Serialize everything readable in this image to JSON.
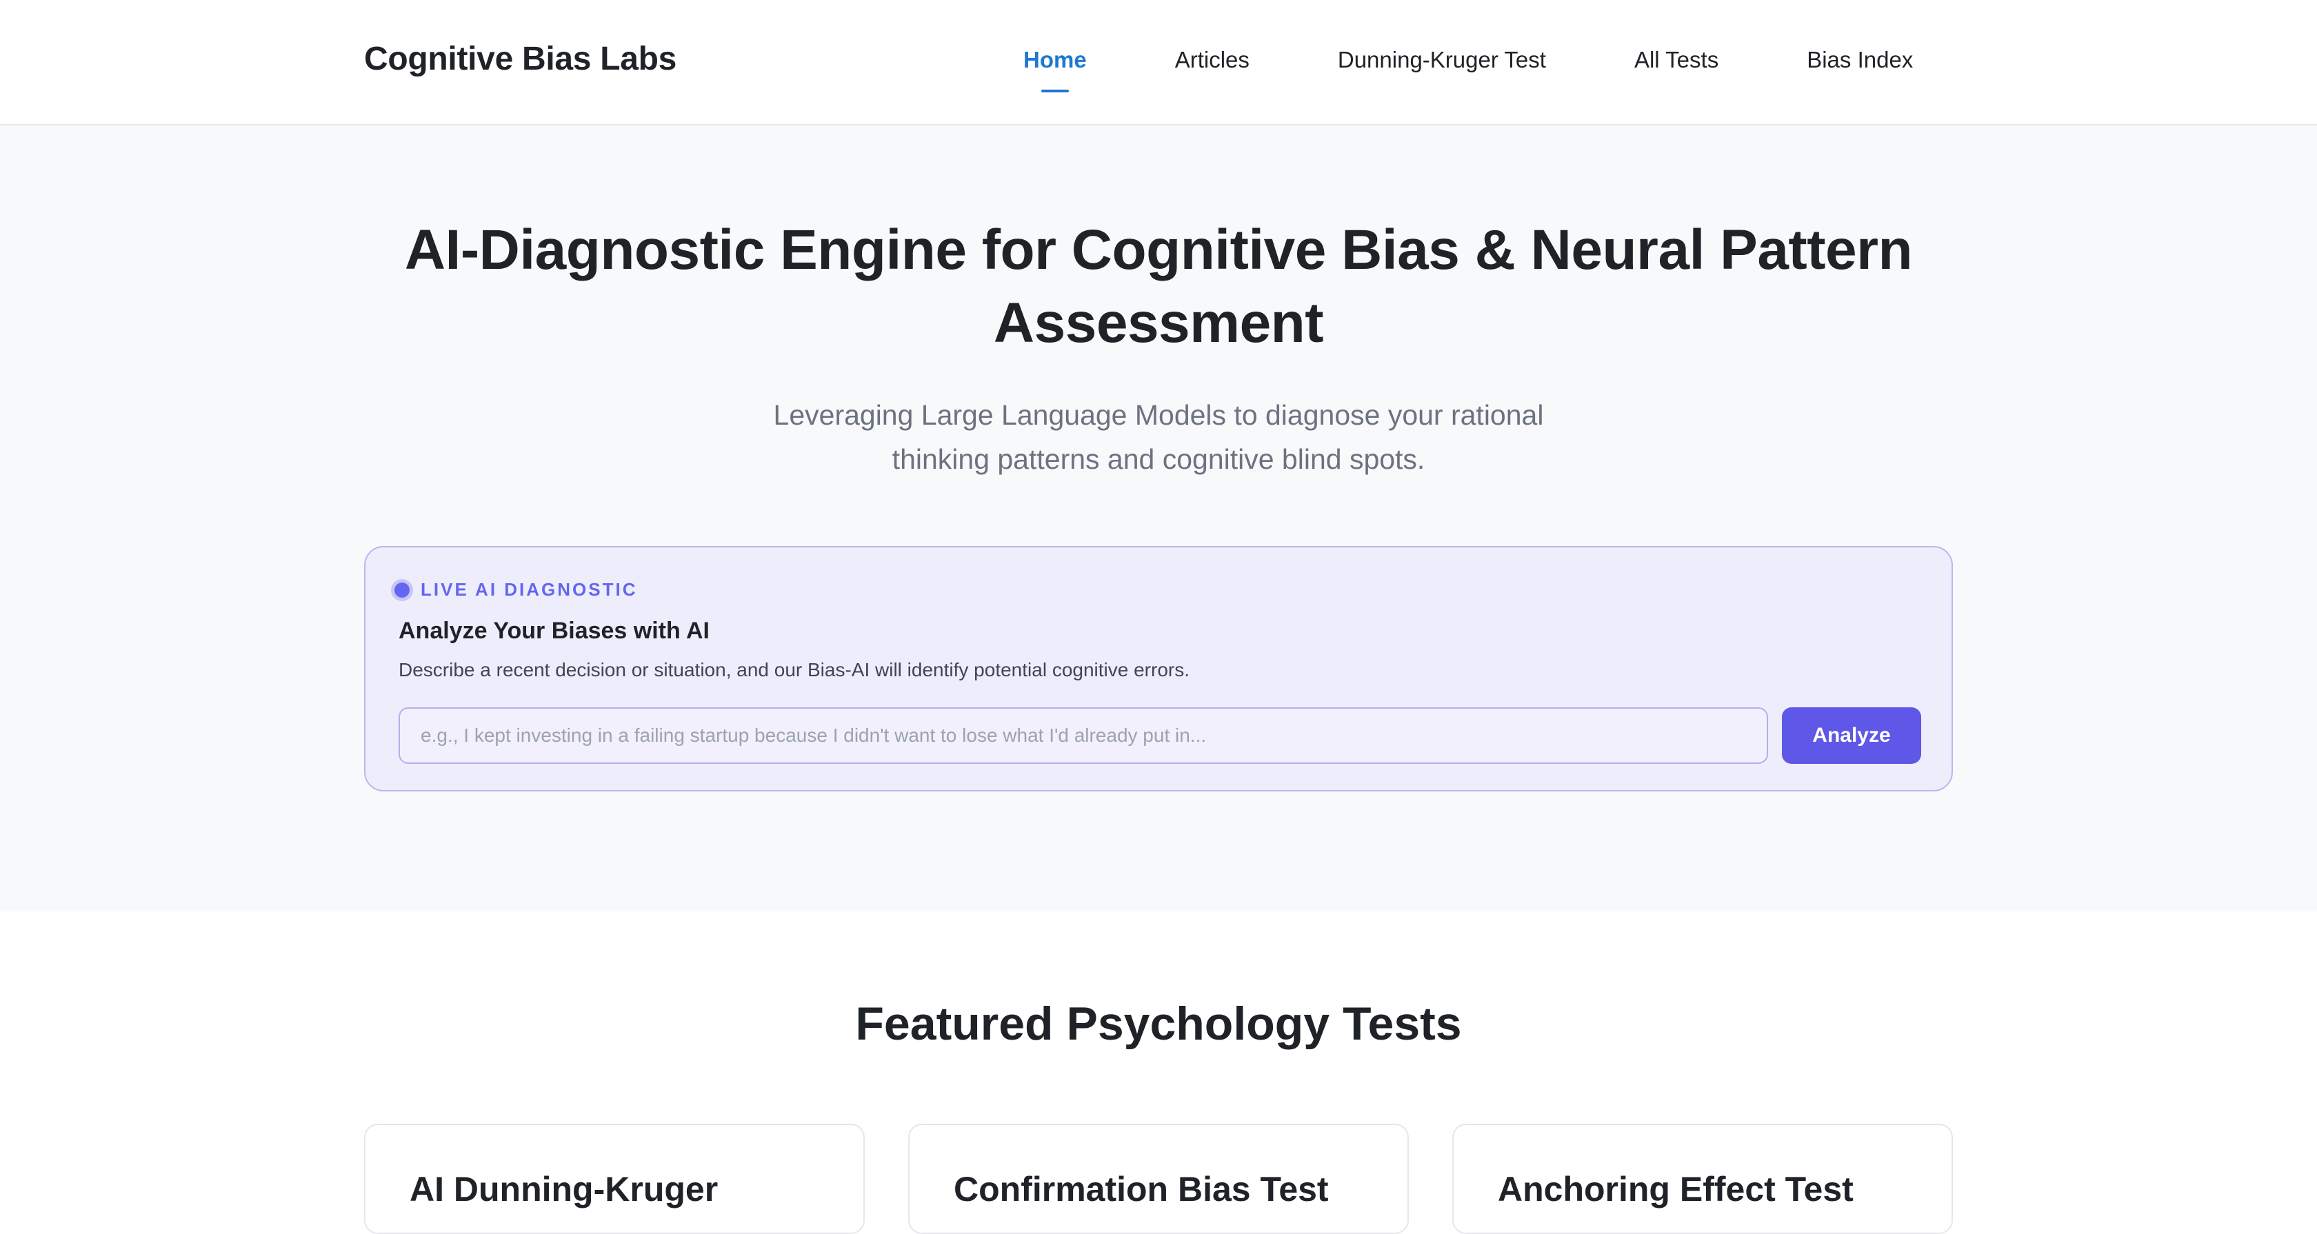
{
  "header": {
    "logo": "Cognitive Bias Labs",
    "nav": [
      {
        "label": "Home",
        "active": true
      },
      {
        "label": "Articles",
        "active": false
      },
      {
        "label": "Dunning-Kruger Test",
        "active": false
      },
      {
        "label": "All Tests",
        "active": false
      },
      {
        "label": "Bias Index",
        "active": false
      }
    ]
  },
  "hero": {
    "title": "AI-Diagnostic Engine for Cognitive Bias & Neural Pattern Assessment",
    "subtitle": "Leveraging Large Language Models to diagnose your rational thinking patterns and cognitive blind spots."
  },
  "diagnostic": {
    "badge": "LIVE AI DIAGNOSTIC",
    "title": "Analyze Your Biases with AI",
    "description": "Describe a recent decision or situation, and our Bias-AI will identify potential cognitive errors.",
    "input_value": "",
    "input_placeholder": "e.g., I kept investing in a failing startup because I didn't want to lose what I'd already put in...",
    "button_label": "Analyze"
  },
  "featured": {
    "title": "Featured Psychology Tests",
    "cards": [
      {
        "title": "AI Dunning-Kruger"
      },
      {
        "title": "Confirmation Bias Test"
      },
      {
        "title": "Anchoring Effect Test"
      }
    ]
  },
  "colors": {
    "accent_blue": "#1f78d1",
    "indigo": "#5f57e8",
    "card_bg": "#eeedfb"
  }
}
